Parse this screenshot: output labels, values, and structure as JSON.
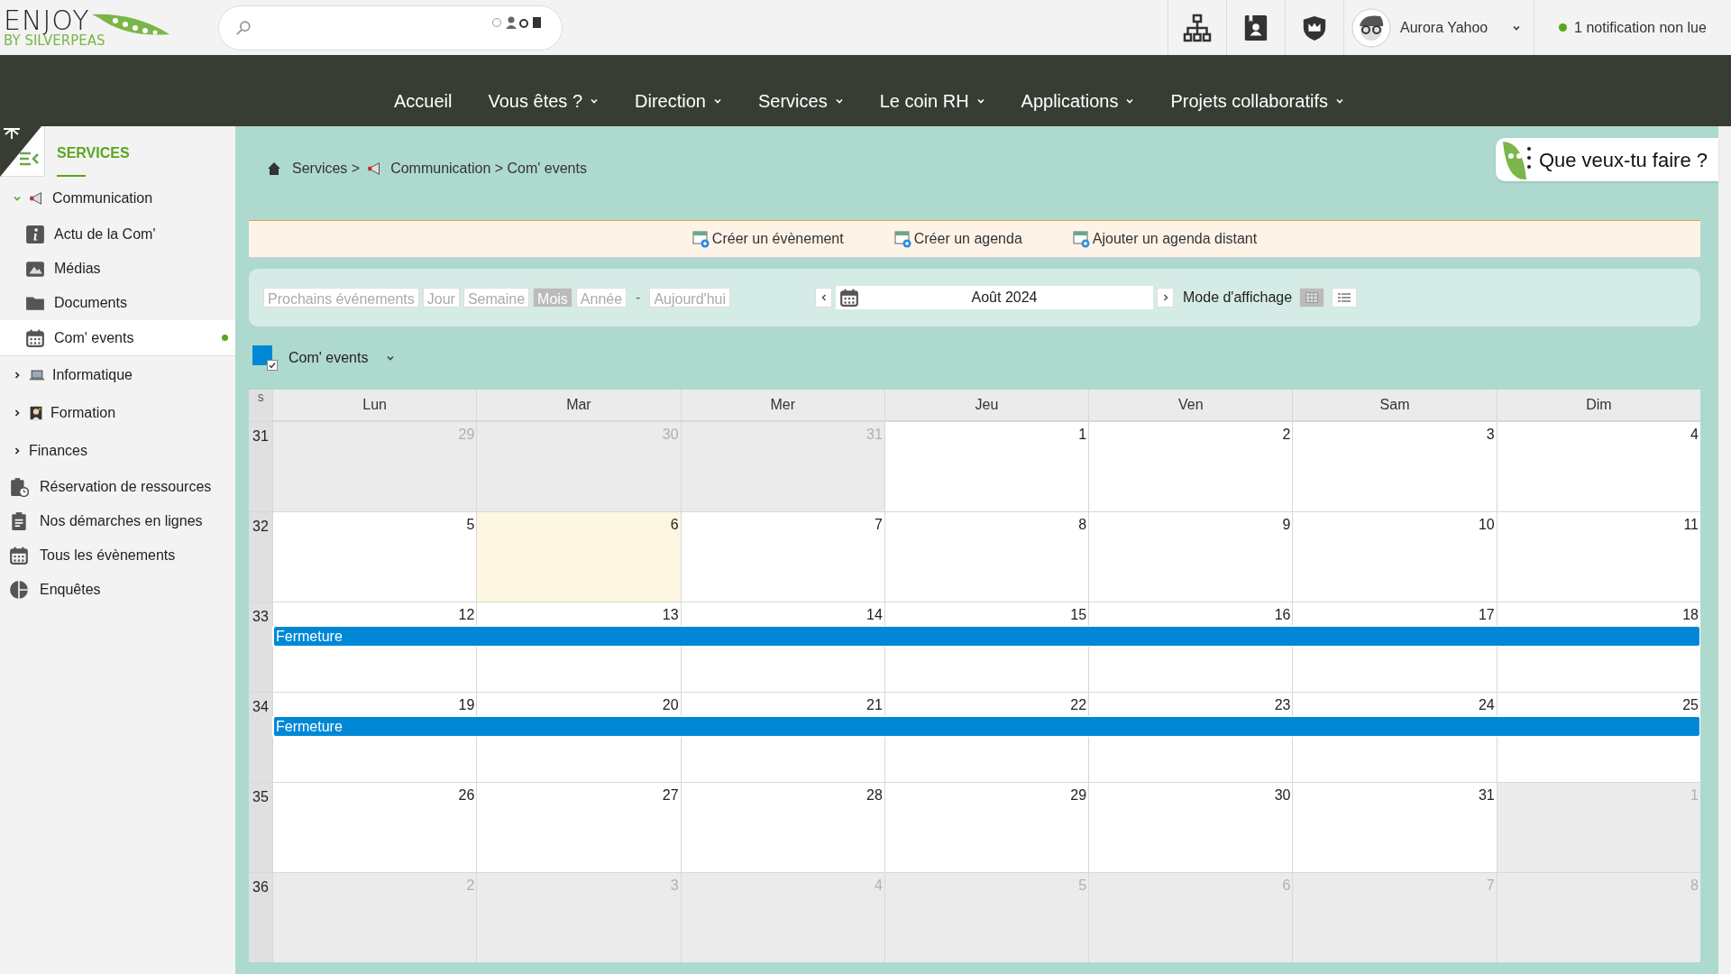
{
  "header": {
    "logo": {
      "title": "ENJOY",
      "subtitle": "BY SILVERPEAS"
    },
    "user": {
      "name": "Aurora Yahoo"
    },
    "notification": {
      "text": "1 notification non lue"
    }
  },
  "nav": [
    {
      "label": "Accueil",
      "dropdown": false
    },
    {
      "label": "Vous êtes ?",
      "dropdown": true
    },
    {
      "label": "Direction",
      "dropdown": true
    },
    {
      "label": "Services",
      "dropdown": true
    },
    {
      "label": "Le coin RH",
      "dropdown": true
    },
    {
      "label": "Applications",
      "dropdown": true
    },
    {
      "label": "Projets collaboratifs",
      "dropdown": true
    }
  ],
  "sidebar": {
    "title": "SERVICES",
    "items": [
      {
        "kind": "space",
        "label": "Communication",
        "expanded": true,
        "selected": false,
        "children": [
          {
            "label": "Actu de la Com'",
            "selected": false,
            "unread": false
          },
          {
            "label": "Médias",
            "selected": false,
            "unread": false
          },
          {
            "label": "Documents",
            "selected": false,
            "unread": false
          },
          {
            "label": "Com' events",
            "selected": true,
            "unread": true
          }
        ]
      },
      {
        "kind": "space",
        "label": "Informatique",
        "expanded": false,
        "selected": false
      },
      {
        "kind": "space",
        "label": "Formation",
        "expanded": false,
        "selected": false
      },
      {
        "kind": "space",
        "label": "Finances",
        "expanded": false,
        "selected": false
      },
      {
        "kind": "app",
        "label": "Réservation de ressources",
        "selected": false
      },
      {
        "kind": "app",
        "label": "Nos démarches en lignes",
        "selected": false
      },
      {
        "kind": "app",
        "label": "Tous les évènements",
        "selected": false
      },
      {
        "kind": "app",
        "label": "Enquêtes",
        "selected": false
      }
    ]
  },
  "breadcrumb": [
    "Services >",
    "Communication > Com' events"
  ],
  "assistant": {
    "label": "Que veux-tu faire ?"
  },
  "actions": [
    "Créer un évènement",
    "Créer un agenda",
    "Ajouter un agenda distant"
  ],
  "views": [
    {
      "label": "Prochains événements",
      "selected": false
    },
    {
      "label": "Jour",
      "selected": false
    },
    {
      "label": "Semaine",
      "selected": false
    },
    {
      "label": "Mois",
      "selected": true
    },
    {
      "label": "Année",
      "selected": false
    }
  ],
  "separator": "-",
  "today": "Aujourd'hui",
  "period": "Août 2024",
  "display_mode": {
    "label": "Mode d'affichage",
    "modes": [
      {
        "kind": "grid",
        "selected": true
      },
      {
        "kind": "list",
        "selected": false
      }
    ]
  },
  "agenda": {
    "name": "Com' events",
    "color": "#0088d7",
    "checked": true
  },
  "calendar": {
    "week_header": "S",
    "days": [
      "Lun",
      "Mar",
      "Mer",
      "Jeu",
      "Ven",
      "Sam",
      "Dim"
    ],
    "weeks": [
      {
        "number": "31",
        "days": [
          {
            "label": "29",
            "other_month": true,
            "today": false
          },
          {
            "label": "30",
            "other_month": true,
            "today": false
          },
          {
            "label": "31",
            "other_month": true,
            "today": false
          },
          {
            "label": "1",
            "other_month": false,
            "today": false
          },
          {
            "label": "2",
            "other_month": false,
            "today": false
          },
          {
            "label": "3",
            "other_month": false,
            "today": false
          },
          {
            "label": "4",
            "other_month": false,
            "today": false
          }
        ]
      },
      {
        "number": "32",
        "days": [
          {
            "label": "5",
            "other_month": false,
            "today": false
          },
          {
            "label": "6",
            "other_month": false,
            "today": true
          },
          {
            "label": "7",
            "other_month": false,
            "today": false
          },
          {
            "label": "8",
            "other_month": false,
            "today": false
          },
          {
            "label": "9",
            "other_month": false,
            "today": false
          },
          {
            "label": "10",
            "other_month": false,
            "today": false
          },
          {
            "label": "11",
            "other_month": false,
            "today": false
          }
        ]
      },
      {
        "number": "33",
        "days": [
          {
            "label": "12",
            "other_month": false,
            "today": false
          },
          {
            "label": "13",
            "other_month": false,
            "today": false
          },
          {
            "label": "14",
            "other_month": false,
            "today": false
          },
          {
            "label": "15",
            "other_month": false,
            "today": false
          },
          {
            "label": "16",
            "other_month": false,
            "today": false
          },
          {
            "label": "17",
            "other_month": false,
            "today": false
          },
          {
            "label": "18",
            "other_month": false,
            "today": false
          }
        ],
        "events": [
          {
            "title": "Fermeture",
            "color": "#0088d7"
          }
        ]
      },
      {
        "number": "34",
        "days": [
          {
            "label": "19",
            "other_month": false,
            "today": false
          },
          {
            "label": "20",
            "other_month": false,
            "today": false
          },
          {
            "label": "21",
            "other_month": false,
            "today": false
          },
          {
            "label": "22",
            "other_month": false,
            "today": false
          },
          {
            "label": "23",
            "other_month": false,
            "today": false
          },
          {
            "label": "24",
            "other_month": false,
            "today": false
          },
          {
            "label": "25",
            "other_month": false,
            "today": false
          }
        ],
        "events": [
          {
            "title": "Fermeture",
            "color": "#0088d7"
          }
        ]
      },
      {
        "number": "35",
        "days": [
          {
            "label": "26",
            "other_month": false,
            "today": false
          },
          {
            "label": "27",
            "other_month": false,
            "today": false
          },
          {
            "label": "28",
            "other_month": false,
            "today": false
          },
          {
            "label": "29",
            "other_month": false,
            "today": false
          },
          {
            "label": "30",
            "other_month": false,
            "today": false
          },
          {
            "label": "31",
            "other_month": false,
            "today": false
          },
          {
            "label": "1",
            "other_month": true,
            "today": false
          }
        ]
      },
      {
        "number": "36",
        "days": [
          {
            "label": "2",
            "other_month": true,
            "today": false
          },
          {
            "label": "3",
            "other_month": true,
            "today": false
          },
          {
            "label": "4",
            "other_month": true,
            "today": false
          },
          {
            "label": "5",
            "other_month": true,
            "today": false
          },
          {
            "label": "6",
            "other_month": true,
            "today": false
          },
          {
            "label": "7",
            "other_month": true,
            "today": false
          },
          {
            "label": "8",
            "other_month": true,
            "today": false
          }
        ]
      }
    ]
  }
}
